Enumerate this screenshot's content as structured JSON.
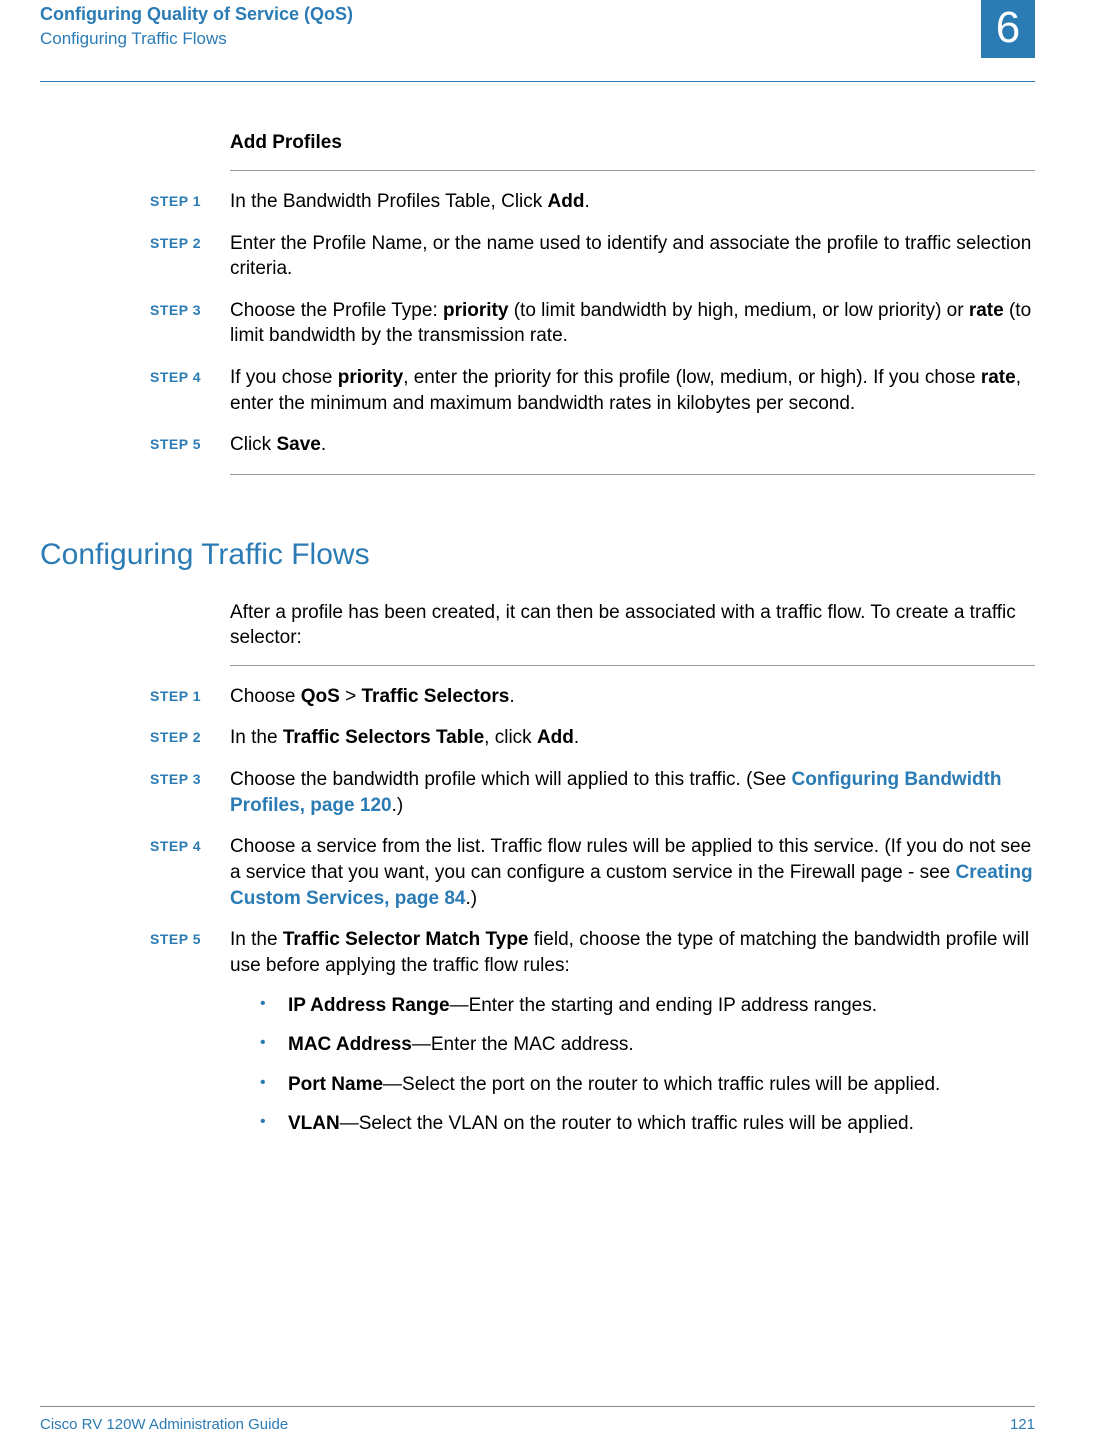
{
  "header": {
    "title": "Configuring Quality of Service (QoS)",
    "subtitle": "Configuring Traffic Flows",
    "chapter_number": "6"
  },
  "section1": {
    "heading": "Add Profiles",
    "steps": [
      {
        "label": "STEP 1",
        "parts": [
          "In the Bandwidth Profiles Table, Click ",
          "Add",
          "."
        ]
      },
      {
        "label": "STEP  2",
        "parts": [
          "Enter the Profile Name, or the name used to identify and associate the profile to traffic selection criteria."
        ]
      },
      {
        "label": "STEP  3",
        "parts": [
          "Choose the Profile Type: ",
          "priority",
          " (to limit bandwidth by high, medium, or low priority) or ",
          "rate",
          " (to limit bandwidth by the transmission rate."
        ]
      },
      {
        "label": "STEP  4",
        "parts": [
          "If you chose ",
          "priority",
          ", enter the priority for this profile (low, medium, or high). If you chose ",
          "rate",
          ", enter the minimum and maximum bandwidth rates in kilobytes per second."
        ]
      },
      {
        "label": "STEP  5",
        "parts": [
          "Click ",
          "Save",
          "."
        ]
      }
    ]
  },
  "section2": {
    "heading": "Configuring Traffic Flows",
    "intro": "After a profile has been created, it can then be associated with a traffic flow. To create a traffic selector:",
    "steps": [
      {
        "label": "STEP 1",
        "parts": [
          "Choose ",
          "QoS",
          " > ",
          "Traffic Selectors",
          "."
        ]
      },
      {
        "label": "STEP  2",
        "parts": [
          "In the ",
          "Traffic Selectors Table",
          ", click ",
          "Add",
          "."
        ]
      },
      {
        "label": "STEP  3",
        "parts": [
          "Choose the bandwidth profile which will applied to this traffic. (See "
        ],
        "link": "Configuring Bandwidth Profiles, page 120",
        "after_link": ".)"
      },
      {
        "label": "STEP  4",
        "parts": [
          "Choose a service from the list. Traffic flow rules will be applied to this service. (If you do not see a service that you want, you can configure a custom service in the Firewall page - see "
        ],
        "link": "Creating Custom Services, page 84",
        "after_link": ".)"
      },
      {
        "label": "STEP  5",
        "parts": [
          "In the ",
          "Traffic Selector Match Type",
          " field, choose the type of matching the bandwidth profile will use before applying the traffic flow rules:"
        ],
        "bullets": [
          {
            "bold": "IP Address Range",
            "rest": "—Enter the starting and ending IP address ranges."
          },
          {
            "bold": "MAC Address",
            "rest": "—Enter the MAC address."
          },
          {
            "bold": "Port Name",
            "rest": "—Select the port on the router to which traffic rules will be applied."
          },
          {
            "bold": "VLAN",
            "rest": "—Select the VLAN on the router to which traffic rules will be applied."
          }
        ]
      }
    ]
  },
  "footer": {
    "left": "Cisco RV 120W Administration Guide",
    "right": "121"
  }
}
